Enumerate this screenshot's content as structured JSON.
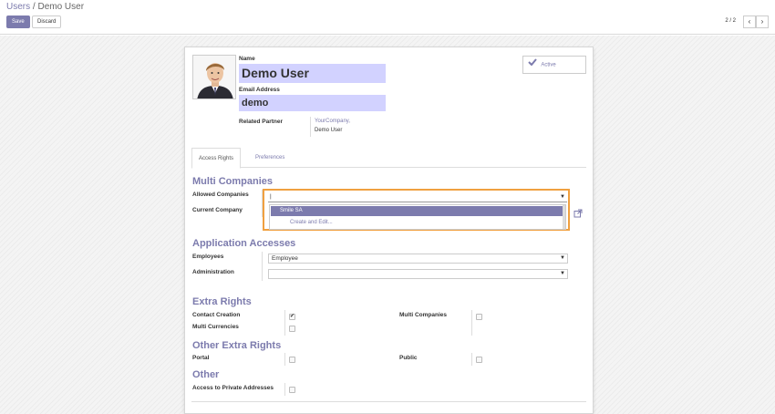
{
  "breadcrumb": {
    "parent": "Users",
    "separator": "/",
    "current": "Demo User"
  },
  "toolbar": {
    "save_label": "Save",
    "discard_label": "Discard"
  },
  "pager": {
    "value": "2 / 2",
    "prev": "‹",
    "next": "›"
  },
  "user": {
    "name_label": "Name",
    "name": "Demo User",
    "email_label": "Email Address",
    "email": "demo",
    "partner_label": "Related Partner",
    "partner_line1": "YourCompany,",
    "partner_line2": "Demo User",
    "active_label": "Active"
  },
  "tabs": [
    {
      "label": "Access Rights"
    },
    {
      "label": "Preferences"
    }
  ],
  "multi_companies": {
    "title": "Multi Companies",
    "allowed_label": "Allowed Companies",
    "allowed_value": "|",
    "current_label": "Current Company"
  },
  "dropdown": {
    "items": [
      "Smile SA"
    ],
    "create_label": "Create and Edit..."
  },
  "app_accesses": {
    "title": "Application Accesses",
    "employees_label": "Employees",
    "employees_value": "Employee",
    "admin_label": "Administration",
    "admin_value": ""
  },
  "extra_rights": {
    "title": "Extra Rights",
    "contact_creation_label": "Contact Creation",
    "contact_creation_checked": true,
    "multi_currencies_label": "Multi Currencies",
    "multi_currencies_checked": false,
    "multi_companies_label": "Multi Companies",
    "multi_companies_checked": false
  },
  "other_extra_rights": {
    "title": "Other Extra Rights",
    "portal_label": "Portal",
    "public_label": "Public"
  },
  "other": {
    "title": "Other",
    "private_label": "Access to Private Addresses"
  },
  "colors": {
    "accent": "#7c7bad",
    "highlight_field": "#d2d2ff",
    "focus_border": "#f0a040"
  }
}
